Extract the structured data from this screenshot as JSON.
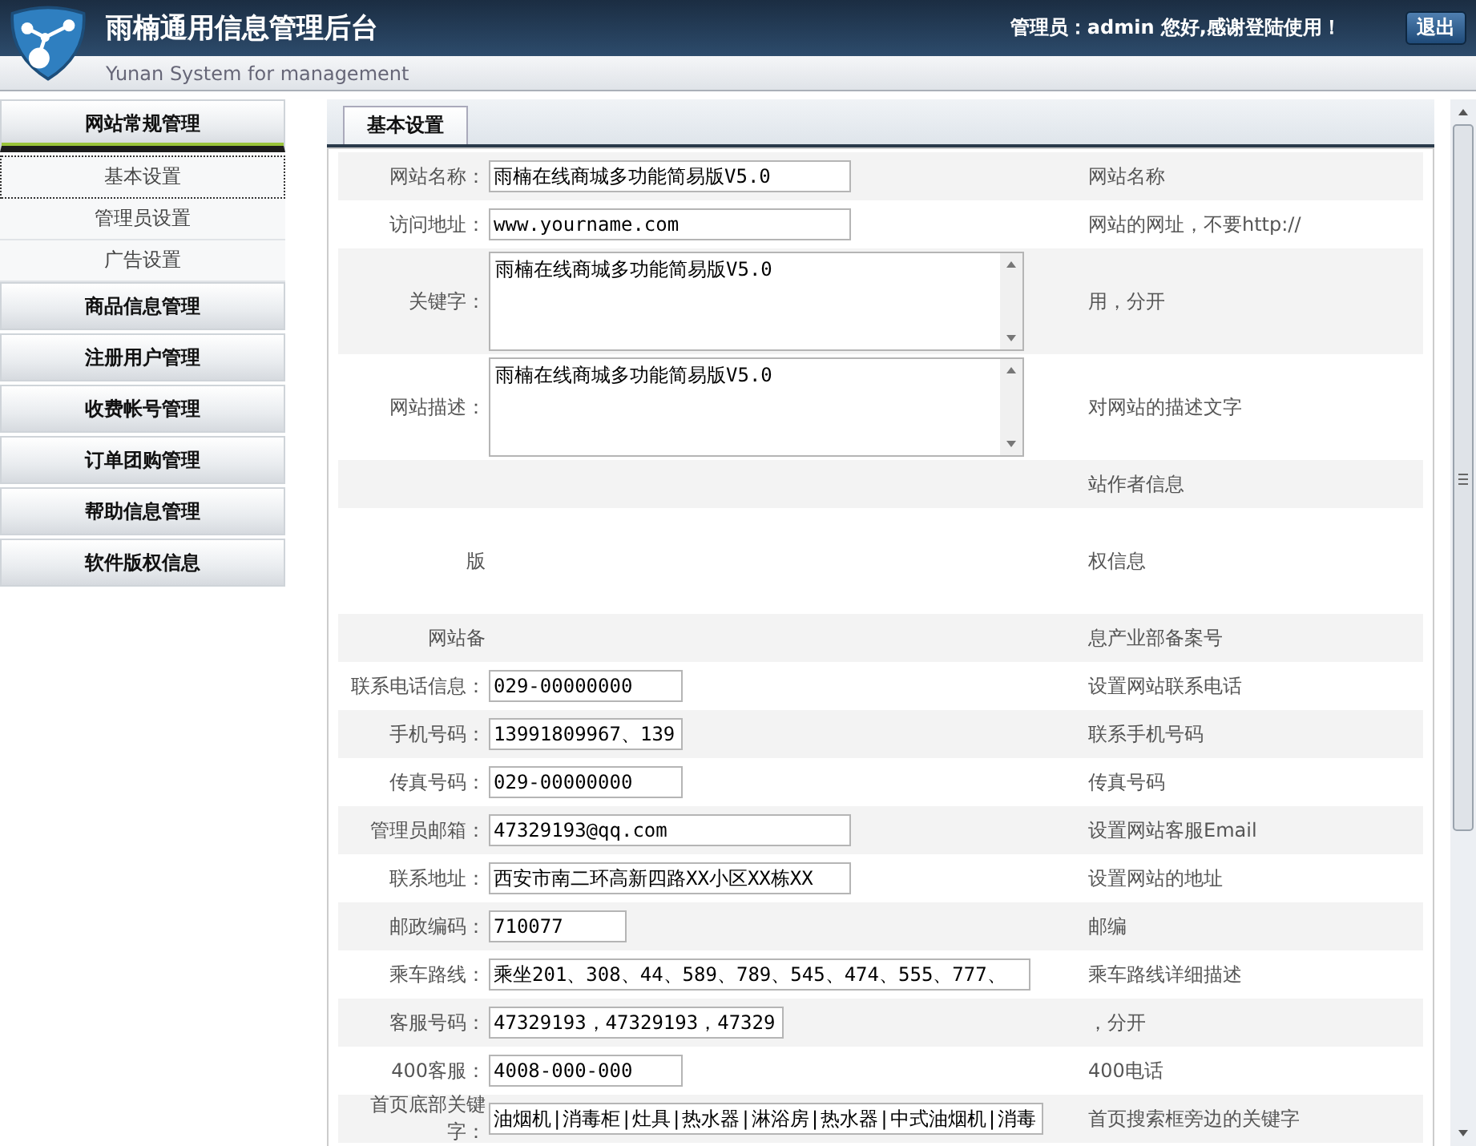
{
  "header": {
    "title": "雨楠通用信息管理后台",
    "subtitle": "Yunan System for management",
    "greeting": "管理员：admin 您好,感谢登陆使用！",
    "logout": "退出"
  },
  "sidebar": [
    {
      "label": "网站常规管理",
      "expanded": true,
      "children": [
        {
          "label": "基本设置",
          "selected": true
        },
        {
          "label": "管理员设置",
          "selected": false
        },
        {
          "label": "广告设置",
          "selected": false
        }
      ]
    },
    {
      "label": "商品信息管理",
      "expanded": false
    },
    {
      "label": "注册用户管理",
      "expanded": false
    },
    {
      "label": "收费帐号管理",
      "expanded": false
    },
    {
      "label": "订单团购管理",
      "expanded": false
    },
    {
      "label": "帮助信息管理",
      "expanded": false
    },
    {
      "label": "软件版权信息",
      "expanded": false
    }
  ],
  "tabs": [
    {
      "label": "基本设置",
      "selected": true
    }
  ],
  "rows": [
    {
      "label": "网站名称：",
      "kind": "input",
      "value": "雨楠在线商城多功能简易版V5.0",
      "note": "网站名称"
    },
    {
      "label": "访问地址：",
      "kind": "input",
      "value": "www.yourname.com",
      "note": "网站的网址，不要http://"
    },
    {
      "label": "关键字：",
      "kind": "textarea",
      "value": "雨楠在线商城多功能简易版V5.0",
      "note": "用，分开"
    },
    {
      "label": "网站描述：",
      "kind": "textarea",
      "value": "雨楠在线商城多功能简易版V5.0",
      "note": "对网站的描述文字"
    },
    {
      "kind": "none",
      "note": "站作者信息"
    },
    {
      "label": "版",
      "kind": "none",
      "note": "权信息",
      "tall": true
    },
    {
      "label": "网站备",
      "kind": "none",
      "note": "息产业部备案号"
    },
    {
      "label": "联系电话信息：",
      "kind": "input",
      "value": "029-00000000",
      "note": "设置网站联系电话"
    },
    {
      "label": "手机号码：",
      "kind": "input",
      "value": "13991809967、139",
      "note": "联系手机号码"
    },
    {
      "label": "传真号码：",
      "kind": "input",
      "value": "029-00000000",
      "note": "传真号码"
    },
    {
      "label": "管理员邮箱：",
      "kind": "input",
      "value": "47329193@qq.com",
      "note": "设置网站客服Email"
    },
    {
      "label": "联系地址：",
      "kind": "input",
      "value": "西安市南二环高新四路XX小区XX栋XX",
      "note": "设置网站的地址"
    },
    {
      "label": "邮政编码：",
      "kind": "input",
      "value": "710077",
      "note": "邮编"
    },
    {
      "label": "乘车路线：",
      "kind": "input",
      "value": "乘坐201、308、44、589、789、545、474、555、777、",
      "note": "乘车路线详细描述"
    },
    {
      "label": "客服号码：",
      "kind": "input",
      "value": "47329193，47329193，47329",
      "note": "，分开"
    },
    {
      "label": "400客服：",
      "kind": "input",
      "value": "4008-000-000",
      "note": "400电话"
    },
    {
      "label": "首页底部关键字：",
      "kind": "input",
      "value": "油烟机|消毒柜|灶具|热水器|淋浴房|热水器|中式油烟机|消毒",
      "note": "首页搜索框旁边的关键字"
    }
  ]
}
